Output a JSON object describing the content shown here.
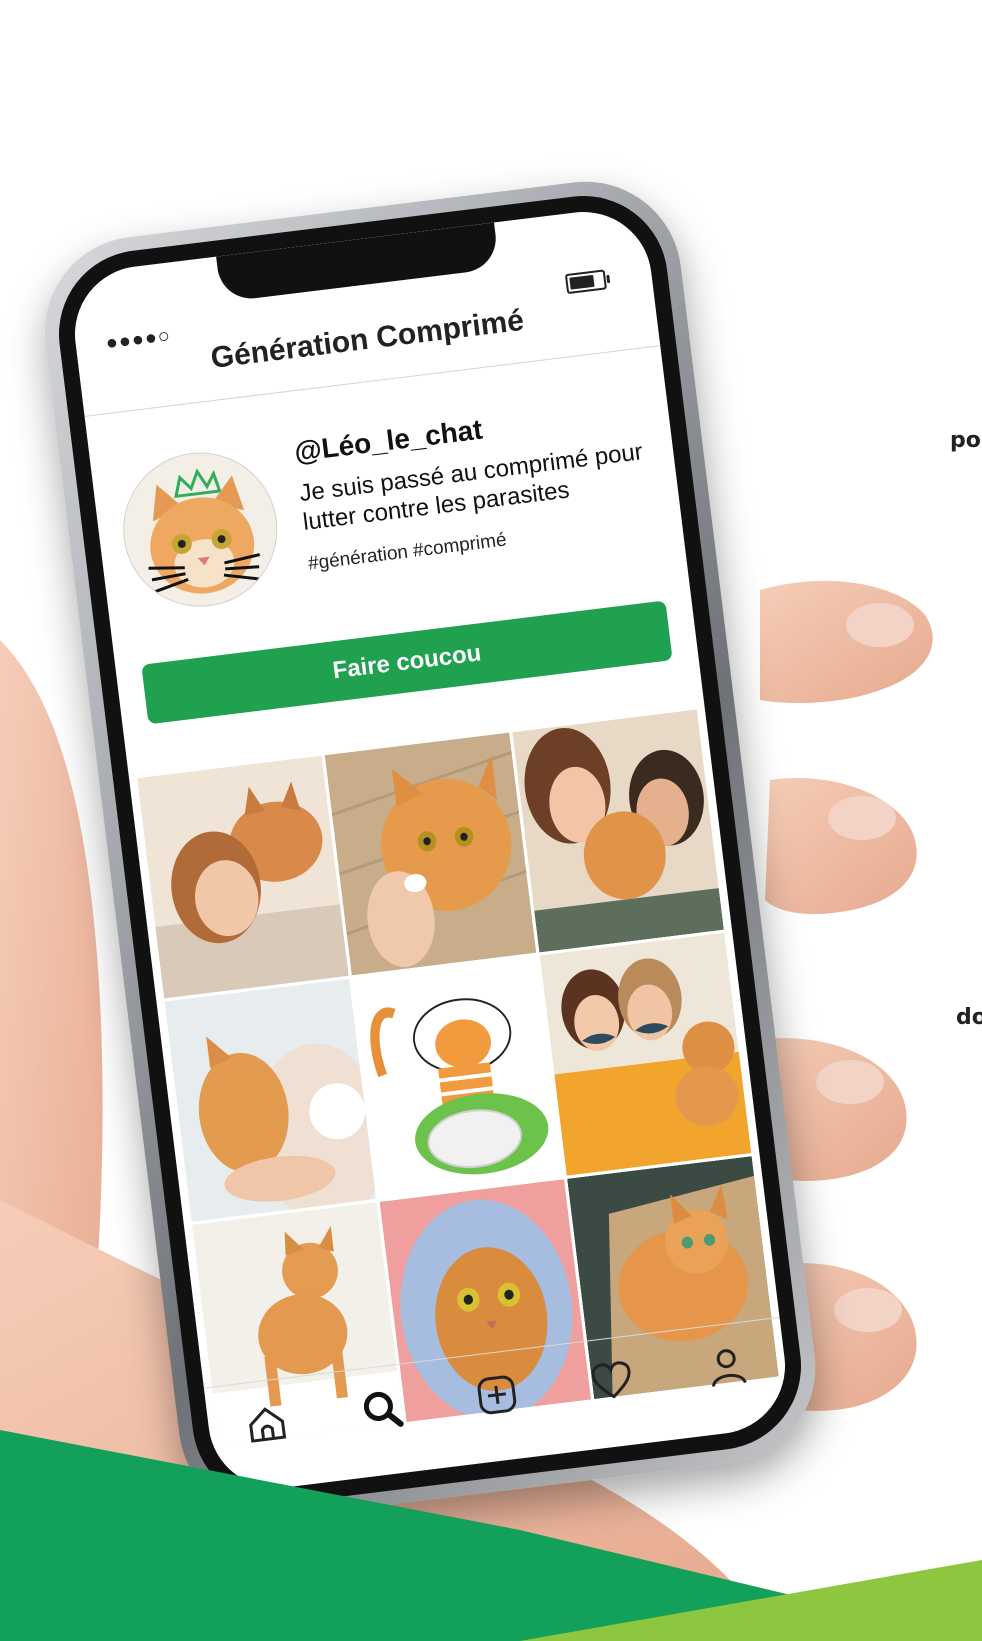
{
  "app": {
    "title": "Génération Comprimé",
    "status_signal": "●●●●○"
  },
  "profile": {
    "handle": "@Léo_le_chat",
    "bio": "Je suis passé au comprimé pour lutter contre les parasites",
    "hashtags": "#génération #comprimé"
  },
  "follow_button": {
    "label": "Faire coucou"
  },
  "grid": {
    "photos": [
      "girl-with-cat-photo",
      "cat-taking-pill-photo",
      "couple-kissing-cat-photo",
      "cat-on-pregnant-belly-photo",
      "cat-drawing-with-pill-illustration",
      "women-with-mustaches-and-cat-photo",
      "standing-cat-photo",
      "cat-in-hood-photo",
      "cat-in-box-photo"
    ]
  },
  "bottom_nav": {
    "icons": [
      "home-icon",
      "search-icon",
      "add-post-icon",
      "heart-icon",
      "profile-icon"
    ]
  },
  "side_text": {
    "fragment_top": "po",
    "fragment_bottom": "do"
  },
  "colors": {
    "brand_green": "#1fa150",
    "banner_green": "#12a05a",
    "banner_light_green": "#8dc63f"
  }
}
